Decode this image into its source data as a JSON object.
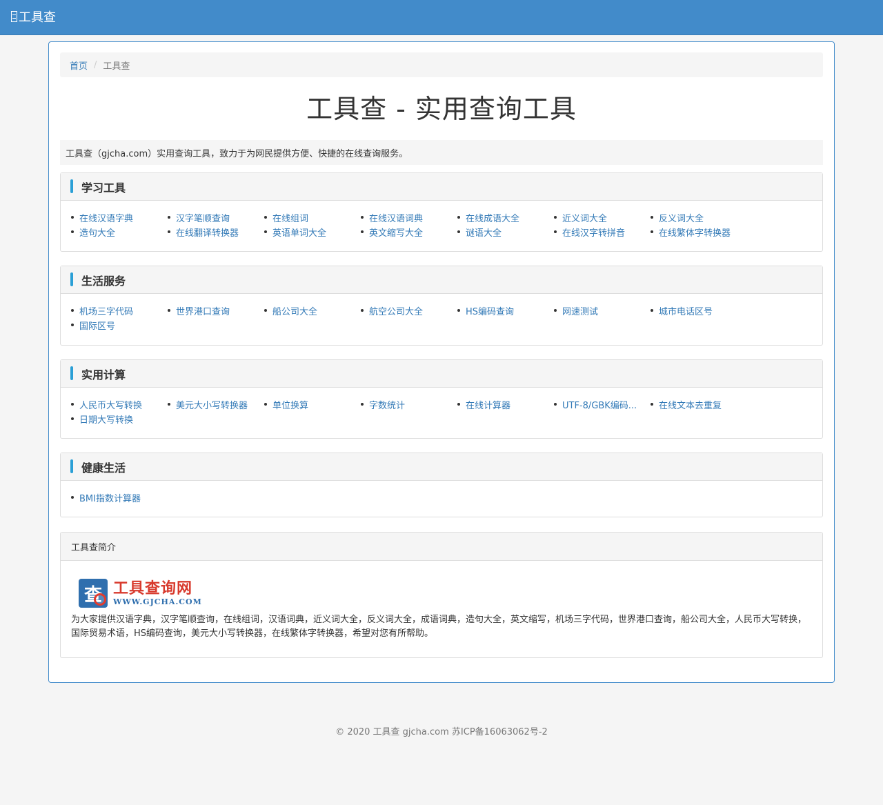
{
  "navbar": {
    "brand": "工具查"
  },
  "breadcrumb": {
    "home": "首页",
    "current": "工具查"
  },
  "page_title": "工具查 - 实用查询工具",
  "intro": "工具查（gjcha.com）实用查询工具，致力于为网民提供方便、快捷的在线查询服务。",
  "sections": [
    {
      "title": "学习工具",
      "links": [
        "在线汉语字典",
        "汉字笔顺查询",
        "在线组词",
        "在线汉语词典",
        "在线成语大全",
        "近义词大全",
        "反义词大全",
        "造句大全",
        "在线翻译转换器",
        "英语单词大全",
        "英文缩写大全",
        "谜语大全",
        "在线汉字转拼音",
        "在线繁体字转换器"
      ]
    },
    {
      "title": "生活服务",
      "links": [
        "机场三字代码",
        "世界港口查询",
        "船公司大全",
        "航空公司大全",
        "HS编码查询",
        "网速测试",
        "城市电话区号",
        "国际区号"
      ]
    },
    {
      "title": "实用计算",
      "links": [
        "人民币大写转换",
        "美元大小写转换器",
        "单位换算",
        "字数统计",
        "在线计算器",
        "UTF-8/GBK编码...",
        "在线文本去重复",
        "日期大写转换"
      ]
    },
    {
      "title": "健康生活",
      "links": [
        "BMI指数计算器"
      ]
    }
  ],
  "about": {
    "title": "工具查简介",
    "logo_cn": "工具查询网",
    "logo_url": "WWW.GJCHA.COM",
    "text": "为大家提供汉语字典，汉字笔顺查询，在线组词，汉语词典，近义词大全，反义词大全，成语词典，造句大全，英文缩写，机场三字代码，世界港口查询，船公司大全，人民币大写转换，国际贸易术语，HS编码查询，美元大小写转换器，在线繁体字转换器，希望对您有所帮助。"
  },
  "footer": "© 2020 工具查 gjcha.com 苏ICP备16063062号-2",
  "colors": {
    "navbar": "#428bca",
    "link": "#337ab7",
    "accent_bar": "#2a9fd6"
  }
}
